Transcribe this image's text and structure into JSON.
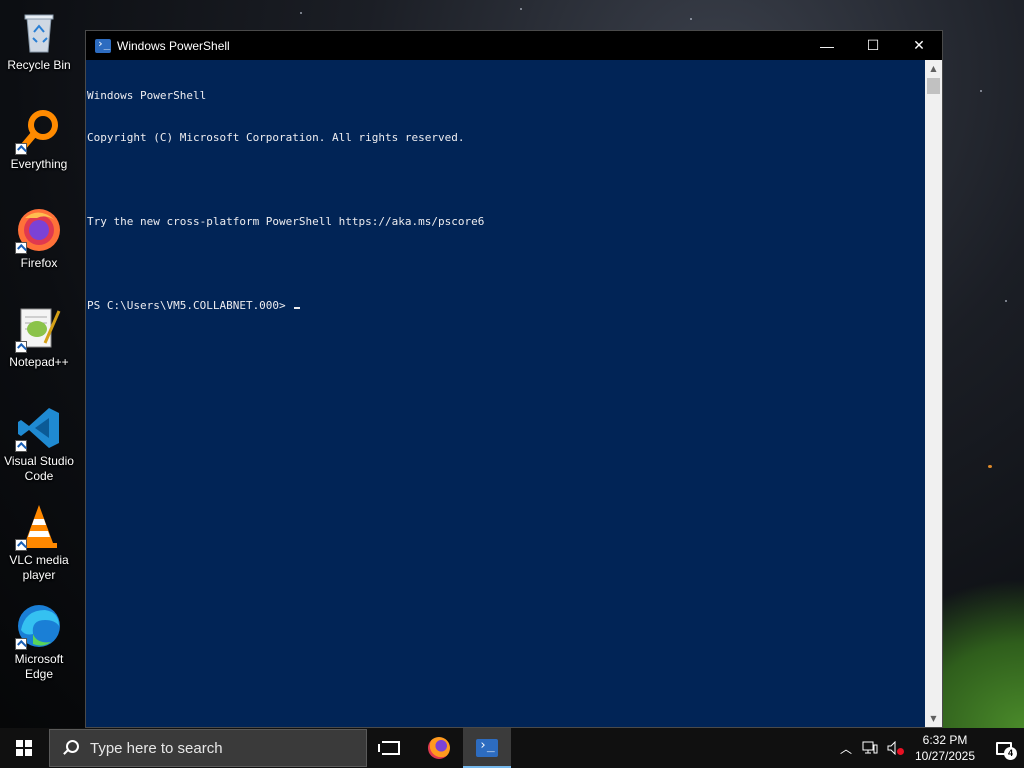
{
  "desktop": {
    "icons": [
      {
        "label": "Recycle Bin",
        "icon": "recycle-bin-icon"
      },
      {
        "label": "Everything",
        "icon": "everything-search-icon"
      },
      {
        "label": "Firefox",
        "icon": "firefox-icon"
      },
      {
        "label": "Notepad++",
        "icon": "notepad-plus-plus-icon"
      },
      {
        "label": "Visual Studio Code",
        "icon": "vscode-icon"
      },
      {
        "label": "VLC media player",
        "icon": "vlc-icon"
      },
      {
        "label": "Microsoft Edge",
        "icon": "edge-icon"
      }
    ]
  },
  "window": {
    "title": "Windows PowerShell",
    "controls": {
      "minimize": "—",
      "maximize": "☐",
      "close": "✕"
    },
    "console_lines": [
      "Windows PowerShell",
      "Copyright (C) Microsoft Corporation. All rights reserved.",
      "",
      "Try the new cross-platform PowerShell https://aka.ms/pscore6",
      ""
    ],
    "prompt": "PS C:\\Users\\VM5.COLLABNET.000> ",
    "colors": {
      "background": "#012456",
      "text": "#eeedf0"
    }
  },
  "taskbar": {
    "search_placeholder": "Type here to search",
    "clock_time": "6:32 PM",
    "clock_date": "10/27/2025",
    "notification_count": "4",
    "accent": "#76b9ed"
  }
}
